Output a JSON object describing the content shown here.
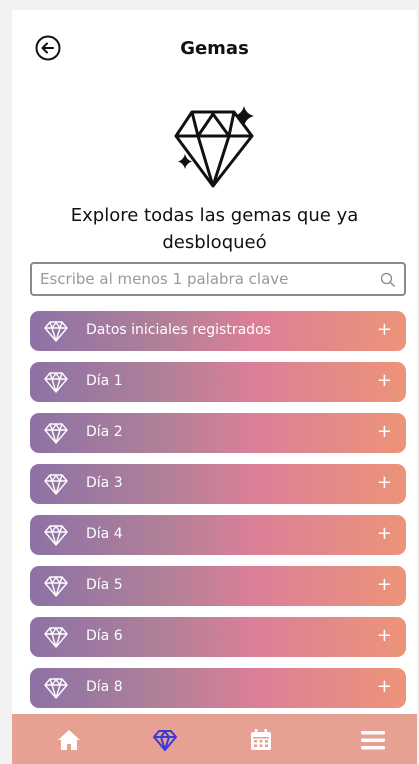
{
  "header": {
    "title": "Gemas",
    "back_icon": "back-arrow-icon"
  },
  "hero": {
    "icon": "diamond-sparkle-icon",
    "subtitle": "Explore todas las gemas que ya desbloqueó"
  },
  "search": {
    "placeholder": "Escribe al menos 1 palabra clave",
    "value": "",
    "icon": "search-icon"
  },
  "gems": [
    {
      "label": "Datos iniciales registrados",
      "icon": "diamond-icon",
      "action": "+"
    },
    {
      "label": "Día 1",
      "icon": "diamond-icon",
      "action": "+"
    },
    {
      "label": "Día 2",
      "icon": "diamond-icon",
      "action": "+"
    },
    {
      "label": "Día 3",
      "icon": "diamond-icon",
      "action": "+"
    },
    {
      "label": "Día 4",
      "icon": "diamond-icon",
      "action": "+"
    },
    {
      "label": "Día 5",
      "icon": "diamond-icon",
      "action": "+"
    },
    {
      "label": "Día 6",
      "icon": "diamond-icon",
      "action": "+"
    },
    {
      "label": "Día 8",
      "icon": "diamond-icon",
      "action": "+"
    }
  ],
  "nav": [
    {
      "name": "home",
      "icon": "home-icon",
      "active": false
    },
    {
      "name": "gems",
      "icon": "diamond-icon",
      "active": true
    },
    {
      "name": "calendar",
      "icon": "calendar-icon",
      "active": false
    },
    {
      "name": "menu",
      "icon": "menu-icon",
      "active": false
    }
  ],
  "colors": {
    "row_gradient_start": "#8d72a6",
    "row_gradient_mid": "#dc7f98",
    "row_gradient_end": "#ec9479",
    "nav_background": "#e7a192",
    "nav_active": "#3b3bd6"
  }
}
